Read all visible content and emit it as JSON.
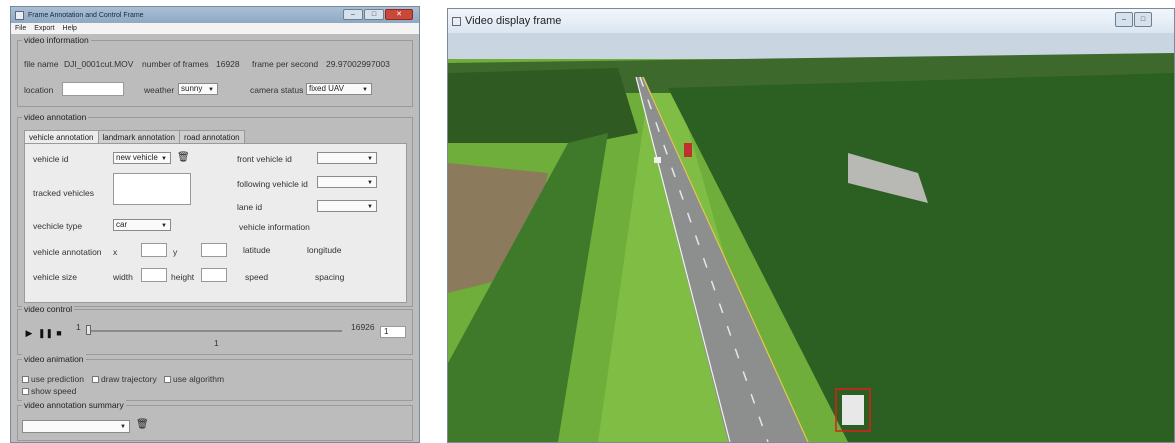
{
  "control_window": {
    "title": "Frame Annotation and Control Frame",
    "menu": [
      "File",
      "Export",
      "Help"
    ],
    "video_information": {
      "group": "video information",
      "file_name_label": "file name",
      "file_name_value": "DJI_0001cut.MOV",
      "frames_label": "number of frames",
      "frames_value": "16928",
      "fps_label": "frame per second",
      "fps_value": "29.97002997003",
      "location_label": "location",
      "location_value": "",
      "weather_label": "weather",
      "weather_value": "sunny",
      "camera_label": "camera status",
      "camera_value": "fixed UAV"
    },
    "video_annotation": {
      "group": "video annotation",
      "tabs": [
        "vehicle annotation",
        "landmark annotation",
        "road annotation"
      ],
      "vehicle_id_label": "vehicle id",
      "vehicle_id_value": "new vehicle",
      "front_vehicle_label": "front vehicle id",
      "following_vehicle_label": "following vehicle id",
      "lane_id_label": "lane id",
      "tracked_label": "tracked vehicles",
      "type_label": "vechicle type",
      "type_value": "car",
      "vehicle_info_label": "vehicle information",
      "annotation_label": "vehicle annotation",
      "x_label": "x",
      "y_label": "y",
      "latitude_label": "latitude",
      "longitude_label": "longitude",
      "size_label": "vehicle size",
      "width_label": "width",
      "height_label": "height",
      "speed_label": "speed",
      "spacing_label": "spacing"
    },
    "video_control": {
      "group": "video control",
      "slider_min": "1",
      "slider_max": "16926",
      "frame_input": "1",
      "current_frame": "1",
      "position": 0.0
    },
    "video_animation": {
      "group": "video animation",
      "use_prediction": "use prediction",
      "draw_trajectory": "draw trajectory",
      "use_algorithm": "use algorithm",
      "show_speed": "show speed"
    },
    "summary": {
      "group": "video annotation summary",
      "value": ""
    }
  },
  "video_window": {
    "title": "Video display frame",
    "colors": {
      "sky": "#c9d6e2",
      "tree_dark": "#2f5a22",
      "grass": "#6fae3a",
      "road": "#8d8f8f",
      "bbox": "#e01b1b"
    }
  }
}
